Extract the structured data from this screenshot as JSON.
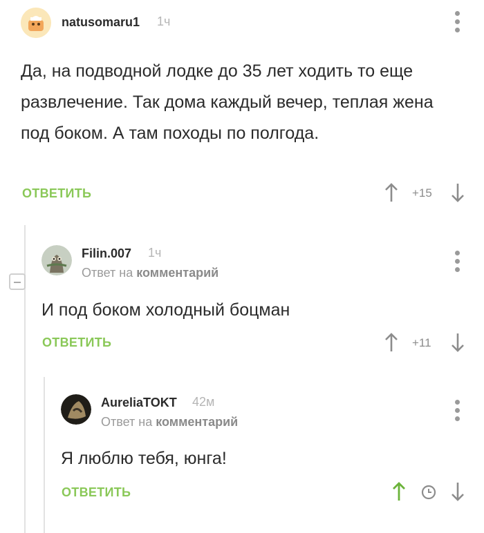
{
  "comments": [
    {
      "author": "natusomaru1",
      "time": "1ч",
      "text": "Да, на подводной лодке до 35 лет ходить то еще развлечение. Так дома каждый вечер, теплая жена под боком. А там походы по полгода.",
      "reply_label": "ОТВЕТИТЬ",
      "rating": "+15"
    },
    {
      "author": "Filin.007",
      "time": "1ч",
      "reply_to_prefix": "Ответ на",
      "reply_to_target": "комментарий",
      "text": "И под боком холодный боцман",
      "reply_label": "ОТВЕТИТЬ",
      "rating": "+11"
    },
    {
      "author": "AureliaTOKT",
      "time": "42м",
      "reply_to_prefix": "Ответ на",
      "reply_to_target": "комментарий",
      "text": "Я люблю тебя, юнга!",
      "reply_label": "ОТВЕТИТЬ",
      "rating_icon": "clock-icon"
    }
  ],
  "colors": {
    "accent_green": "#8ac858",
    "upvoted_green": "#6bb33a",
    "muted_gray": "#9a9a9a"
  }
}
